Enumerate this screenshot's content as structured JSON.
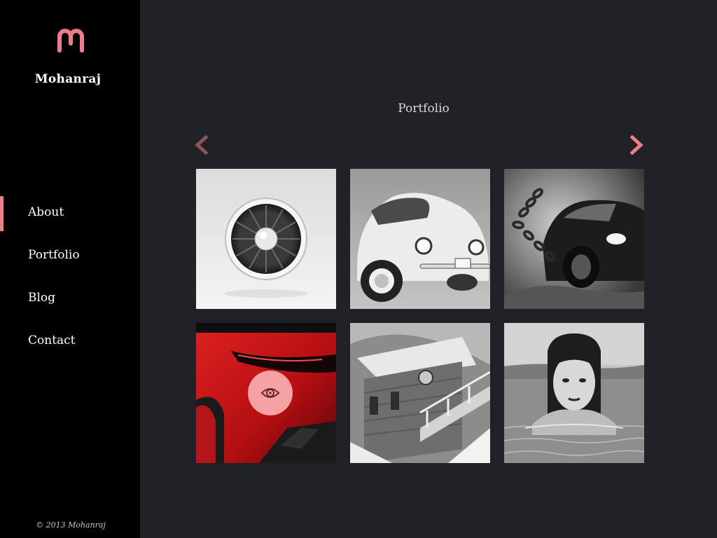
{
  "brand": {
    "name": "Mohanraj",
    "logo_icon": "m-logo-icon",
    "accent_color": "#f07d86"
  },
  "nav": {
    "items": [
      {
        "label": "About",
        "active": true
      },
      {
        "label": "Portfolio",
        "active": false
      },
      {
        "label": "Blog",
        "active": false
      },
      {
        "label": "Contact",
        "active": false
      }
    ]
  },
  "footer": {
    "copyright": "© 2013  Mohanraj"
  },
  "portfolio": {
    "title": "Portfolio",
    "prev_icon": "chevron-left-icon",
    "next_icon": "chevron-right-icon",
    "items": [
      {
        "subject": "jet engine turbine",
        "style": "grayscale"
      },
      {
        "subject": "classic beetle car",
        "style": "grayscale"
      },
      {
        "subject": "muscle car with chains",
        "style": "grayscale"
      },
      {
        "subject": "red sports car rear",
        "style": "color",
        "hover_icon": "eye-icon"
      },
      {
        "subject": "wooden cabin in snow",
        "style": "grayscale"
      },
      {
        "subject": "woman in water",
        "style": "grayscale"
      }
    ]
  }
}
